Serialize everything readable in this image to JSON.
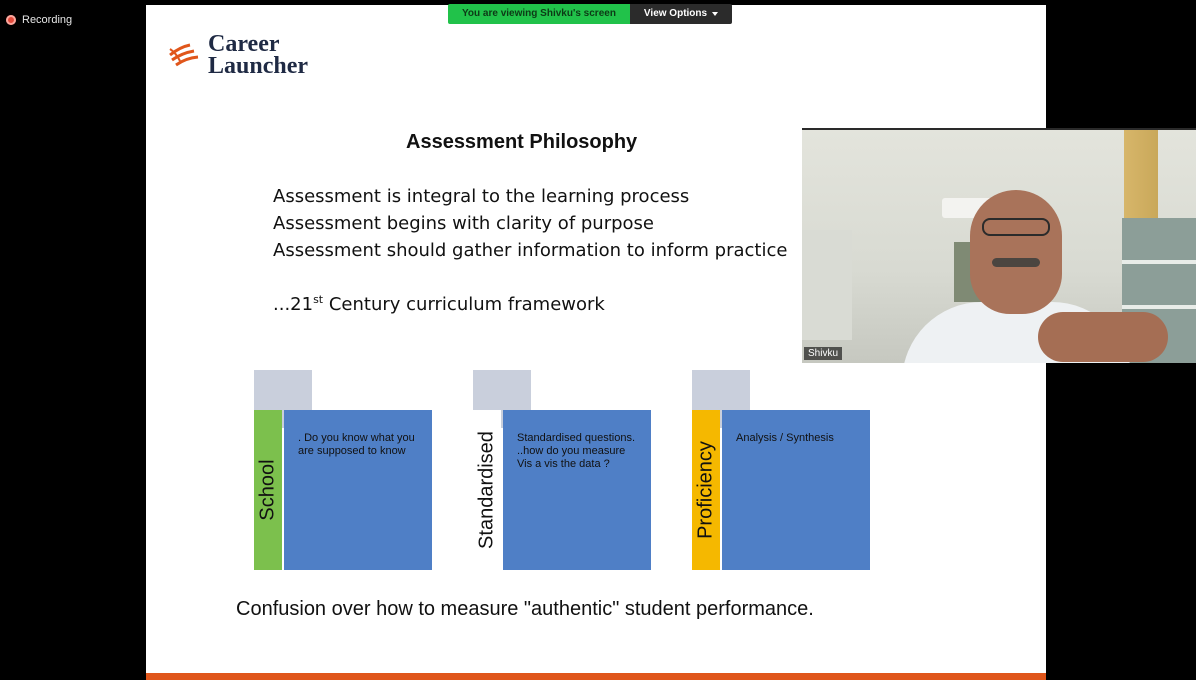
{
  "recording": {
    "label": "Recording"
  },
  "banner": {
    "viewing_text": "You are viewing Shivku's screen",
    "view_options_label": "View Options"
  },
  "slide": {
    "logo": {
      "line1": "Career",
      "line2": "Launcher"
    },
    "title": "Assessment Philosophy",
    "bullets": [
      "Assessment is integral to the learning process",
      "Assessment begins with clarity of purpose",
      "Assessment should gather information to inform practice"
    ],
    "century": {
      "prefix": "...21",
      "sup": "st",
      "suffix": " Century curriculum framework"
    },
    "boxes": [
      {
        "label": "School",
        "text": ". Do you know what you are supposed to know",
        "bar_color": "#7cc04d"
      },
      {
        "label": "Standardised",
        "text": "Standardised questions. ..how do you measure Vis a vis the data ?",
        "bar_color": "#ffffff"
      },
      {
        "label": "Proficiency",
        "text": "Analysis / Synthesis",
        "bar_color": "#f5b800"
      }
    ],
    "bottom_text": "Confusion over how to measure \"authentic\" student performance."
  },
  "video": {
    "participant_name": "Shivku"
  },
  "colors": {
    "accent_orange": "#e0561b",
    "banner_green": "#21c24a",
    "box_blue": "#4f7fc6"
  }
}
